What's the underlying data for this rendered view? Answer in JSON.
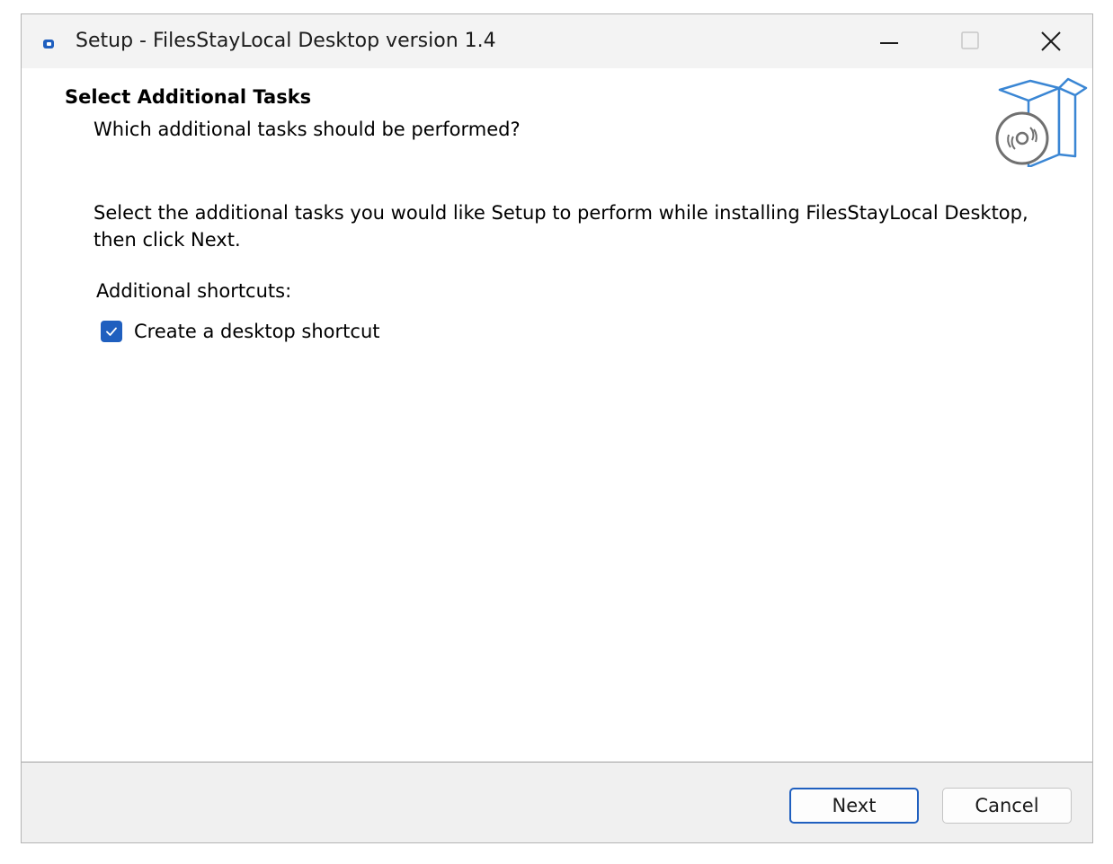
{
  "window": {
    "title": "Setup - FilesStayLocal Desktop version 1.4",
    "app_icon": "setup-app-icon",
    "controls": {
      "minimize_icon": "minimize-icon",
      "maximize_icon": "maximize-icon",
      "close_icon": "close-icon"
    }
  },
  "header": {
    "title": "Select Additional Tasks",
    "subtitle": "Which additional tasks should be performed?",
    "graphic_icon": "setup-box-disc-icon"
  },
  "main": {
    "instructions": "Select the additional tasks you would like Setup to perform while installing FilesStayLocal Desktop, then click Next.",
    "group_label": "Additional shortcuts:",
    "tasks": [
      {
        "label": "Create a desktop shortcut",
        "checked": true
      }
    ]
  },
  "footer": {
    "next_label": "Next",
    "cancel_label": "Cancel"
  },
  "colors": {
    "accent": "#1f5fbf",
    "titlebar_bg": "#f3f3f3",
    "footer_bg": "#f0f0f0"
  }
}
